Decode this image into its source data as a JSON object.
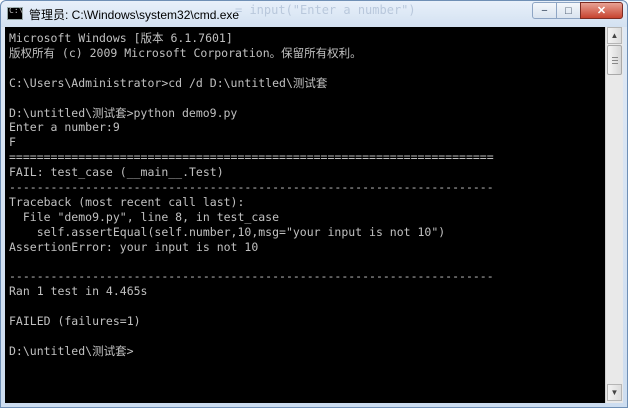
{
  "window": {
    "title": "管理员: C:\\Windows\\system32\\cmd.exe",
    "background_ghost": "=  input(\"Enter a number\")",
    "icon_label": "C:\\",
    "controls": {
      "minimize": "−",
      "maximize": "□",
      "close": "✕"
    }
  },
  "console": {
    "text_color": "#c0c0c0",
    "background": "#000000",
    "lines": [
      "Microsoft Windows [版本 6.1.7601]",
      "版权所有 (c) 2009 Microsoft Corporation。保留所有权利。",
      "",
      "C:\\Users\\Administrator>cd /d D:\\untitled\\测试套",
      "",
      "D:\\untitled\\测试套>python demo9.py",
      "Enter a number:9",
      "F",
      "======================================================================",
      "FAIL: test_case (__main__.Test)",
      "----------------------------------------------------------------------",
      "Traceback (most recent call last):",
      "  File \"demo9.py\", line 8, in test_case",
      "    self.assertEqual(self.number,10,msg=\"your input is not 10\")",
      "AssertionError: your input is not 10",
      "",
      "----------------------------------------------------------------------",
      "Ran 1 test in 4.465s",
      "",
      "FAILED (failures=1)",
      "",
      "D:\\untitled\\测试套>"
    ]
  },
  "scrollbar": {
    "up": "▲",
    "down": "▼"
  }
}
